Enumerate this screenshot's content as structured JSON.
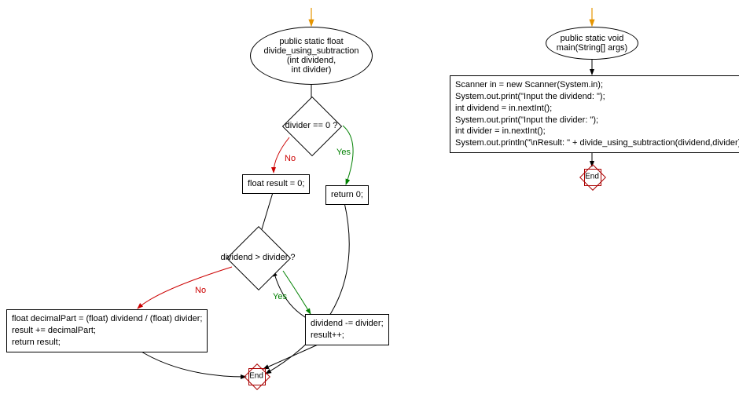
{
  "left": {
    "start_ellipse": {
      "l1": "public static float",
      "l2": "divide_using_subtraction",
      "l3": "(int dividend,",
      "l4": "int divider)"
    },
    "decision1": "divider == 0 ?",
    "return0": "return 0;",
    "result_init": "float result = 0;",
    "decision2": "dividend > divider ?",
    "loop_body": {
      "l1": "dividend -= divider;",
      "l2": "result++;"
    },
    "no_branch": {
      "l1": "float decimalPart = (float) dividend / (float) divider;",
      "l2": "result += decimalPart;",
      "l3": "return result;"
    },
    "edge_yes1": "Yes",
    "edge_no1": "No",
    "edge_yes2": "Yes",
    "edge_no2": "No",
    "end": "End"
  },
  "right": {
    "start_ellipse": {
      "l1": "public static void",
      "l2": "main(String[] args)"
    },
    "body": {
      "l1": "Scanner in = new Scanner(System.in);",
      "l2": "System.out.print(\"Input the dividend: \");",
      "l3": "int dividend = in.nextInt();",
      "l4": "System.out.print(\"Input the divider: \");",
      "l5": "int divider = in.nextInt();",
      "l6": "System.out.println(\"\\nResult: \" + divide_using_subtraction(dividend,divider));"
    },
    "end": "End"
  }
}
